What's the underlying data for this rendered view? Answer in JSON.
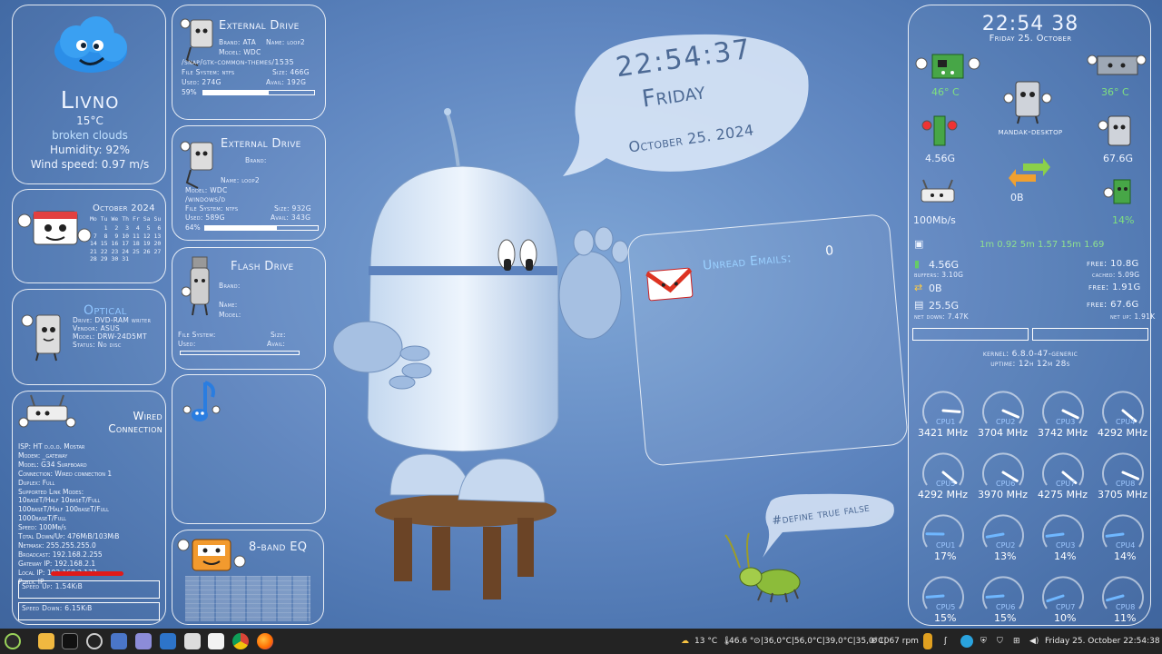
{
  "weather": {
    "city": "Livno",
    "temp": "15°C",
    "condition": "broken clouds",
    "humidity": "Humidity: 92%",
    "wind": "Wind speed: 0.97 m/s"
  },
  "calendar": {
    "title": "October 2024",
    "header": "Mo Tu We Th Fr Sa Su",
    "rows": [
      "    1  2  3  4  5  6",
      " 7  8  9 10 11 12 13",
      "14 15 16 17 18 19 20",
      "21 22 23 24 25 26 27",
      "28 29 30 31"
    ]
  },
  "optical": {
    "title": "Optical",
    "drive": "Drive: DVD-RAM writer",
    "vendor": "Vendor: ASUS",
    "model": "Model: DRW-24D5MT",
    "status": "Status: No disc"
  },
  "network": {
    "title": "Wired Connection",
    "lines": [
      "ISP: HT d.o.o. Mostar",
      "Modem: _gateway",
      "Model: G34 Surfboard",
      "Connection: Wired connection 1",
      "Duplex: Full",
      "Supported Link Modes:",
      "10baseT/Half 10baseT/Full",
      "100baseT/Half 100baseT/Full",
      "1000baseT/Full",
      "Speed: 100Mb/s",
      "Total Down/Up: 476MiB/103MiB",
      "Netmask: 255.255.255.0",
      "Broadcast: 192.168.2.255",
      "Gateway IP: 192.168.2.1",
      "Local IP: 192.168.2.177",
      "Public IP:"
    ],
    "speed_up": "Speed Up: 1.54KiB",
    "speed_down": "Speed Down: 6.15KiB"
  },
  "drive1": {
    "title": "External Drive",
    "brand": "Brand: ATA",
    "name": "Name: loop2",
    "model": "Model: WDC",
    "path": "/snap/gtk-common-themes/1535",
    "fs": "File System: ntfs",
    "size": "Size: 466G",
    "used": "Used: 274G",
    "avail": "Avail: 192G",
    "percent_label": "59%",
    "percent": 59
  },
  "drive2": {
    "title": "External Drive",
    "brand": "Brand:",
    "name": "Name: loop2",
    "model": "Model: WDC",
    "path": "/windows/d",
    "fs": "File System: ntfs",
    "size": "Size: 932G",
    "used": "Used: 589G",
    "avail": "Avail: 343G",
    "percent_label": "64%",
    "percent": 64
  },
  "flash": {
    "title": "Flash Drive",
    "brand": "Brand:",
    "name": "Name:",
    "model": "Model:",
    "fs": "File System:",
    "size": "Size:",
    "used": "Used:",
    "avail": "Avail:"
  },
  "eq": {
    "title": "8-band EQ"
  },
  "clock_bubble": {
    "time": "22:54:37",
    "day": "Friday",
    "date": "October 25. 2024"
  },
  "email": {
    "label": "Unread Emails:",
    "count": "0"
  },
  "define_bubble": "#define true false",
  "system": {
    "time": "22:54 38",
    "date": "Friday 25. October",
    "mobo_temp": "46° C",
    "gpu_temp": "36° C",
    "hostname": "mandak-desktop",
    "ram": "4.56G",
    "hdd": "67.6G",
    "net_total": "0B",
    "net_speed": "100Mb/s",
    "cpu_load": "14%",
    "loadavg": "1m 0.92  5m 1.57  15m 1.69",
    "mem_used": "4.56G",
    "mem_free": "free: 10.8G",
    "buffers": "buffers: 3.10G",
    "cached": "cached: 5.09G",
    "swap_used": "0B",
    "swap_free": "free: 1.91G",
    "disk_used": "25.5G",
    "disk_free": "free: 67.6G",
    "net_down": "net down: 7.47K",
    "net_up": "net up: 1.91K",
    "kernel": "kernel: 6.8.0-47-generic",
    "uptime": "uptime: 12h 12m 28s"
  },
  "cpu_freq": [
    {
      "label": "CPU1",
      "value": "3421 MHz",
      "frac": 0.85
    },
    {
      "label": "CPU2",
      "value": "3704 MHz",
      "frac": 0.92
    },
    {
      "label": "CPU3",
      "value": "3742 MHz",
      "frac": 0.93
    },
    {
      "label": "CPU4",
      "value": "4292 MHz",
      "frac": 0.98
    },
    {
      "label": "CPU5",
      "value": "4292 MHz",
      "frac": 0.98
    },
    {
      "label": "CPU6",
      "value": "3970 MHz",
      "frac": 0.95
    },
    {
      "label": "CPU7",
      "value": "4275 MHz",
      "frac": 0.98
    },
    {
      "label": "CPU8",
      "value": "3705 MHz",
      "frac": 0.92
    }
  ],
  "cpu_load_gauges": [
    {
      "label": "CPU1",
      "value": "17%",
      "frac": 0.17
    },
    {
      "label": "CPU2",
      "value": "13%",
      "frac": 0.13
    },
    {
      "label": "CPU3",
      "value": "14%",
      "frac": 0.14
    },
    {
      "label": "CPU4",
      "value": "14%",
      "frac": 0.14
    },
    {
      "label": "CPU5",
      "value": "15%",
      "frac": 0.15
    },
    {
      "label": "CPU6",
      "value": "15%",
      "frac": 0.15
    },
    {
      "label": "CPU7",
      "value": "10%",
      "frac": 0.1
    },
    {
      "label": "CPU8",
      "value": "11%",
      "frac": 0.11
    }
  ],
  "taskbar": {
    "weather": "13 °C",
    "temp": "46.6 °",
    "sensors": "|36,0°C|56,0°C|39,0°C|35,0°C|",
    "fan": "1067 rpm",
    "clock": "Friday 25. October 22:54:38"
  }
}
